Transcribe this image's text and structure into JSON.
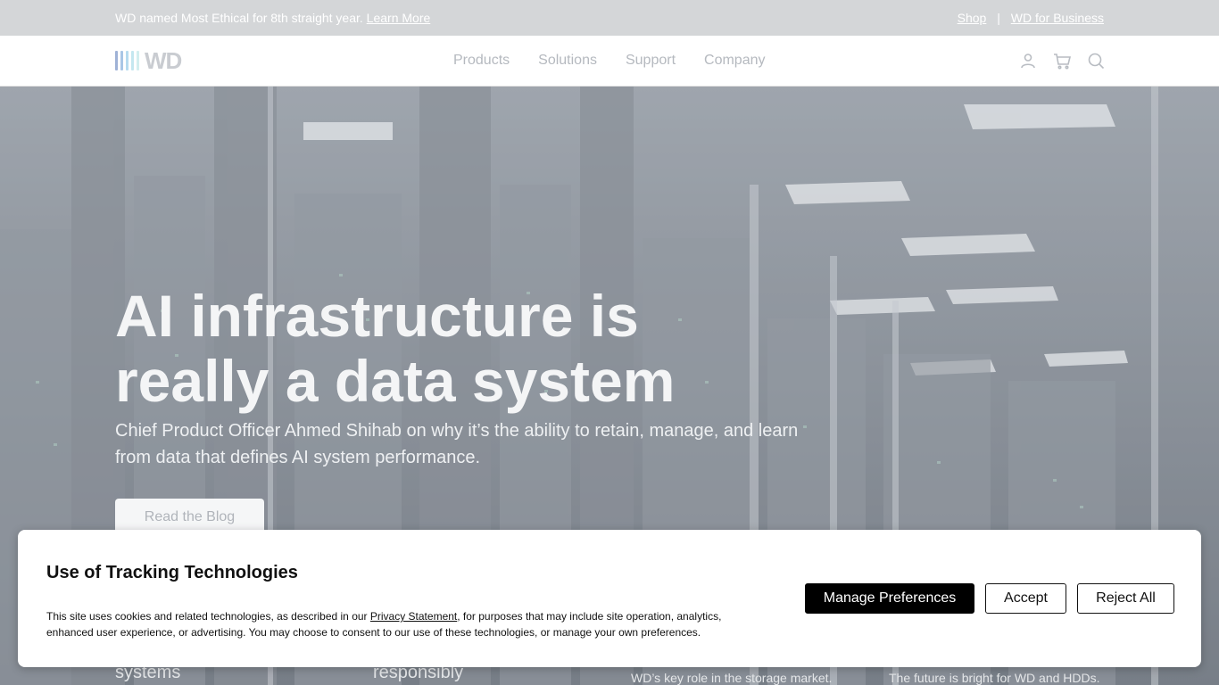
{
  "topbar": {
    "message": "WD named Most Ethical for 8th straight year.",
    "learn_more": "Learn More",
    "shop": "Shop",
    "separator": "|",
    "business": "WD for Business"
  },
  "header": {
    "logo_text": "WD",
    "nav": [
      "Products",
      "Solutions",
      "Support",
      "Company"
    ],
    "icons": [
      "user-icon",
      "cart-icon",
      "search-icon"
    ]
  },
  "hero": {
    "title_line1": "AI infrastructure is",
    "title_line2": "really a data system",
    "subtitle": "Chief Product Officer Ahmed Shihab on why it’s the ability to retain, manage, and learn from data that defines AI system performance.",
    "cta": "Read the Blog"
  },
  "cards_peek": [
    "systems",
    "responsibly",
    "WD’s key role in the storage market.",
    "The future is bright for WD and HDDs."
  ],
  "cookie": {
    "title": "Use of Tracking Technologies",
    "text_before": "This site uses cookies and related technologies, as described in our ",
    "link": "Privacy Statement",
    "text_after": ", for purposes that may include site operation, analytics, enhanced user experience, or advertising. You may choose to consent to our use of these technologies, or manage your own preferences.",
    "manage": "Manage Preferences",
    "accept": "Accept",
    "reject": "Reject All"
  },
  "colors": {
    "topbar_bg": "#d4d6d8",
    "cookie_primary": "#000000",
    "logo_bars": [
      "#9fb2d6",
      "#a9c6e6",
      "#b6dbef",
      "#c4e7f0",
      "#d2eeef"
    ]
  }
}
